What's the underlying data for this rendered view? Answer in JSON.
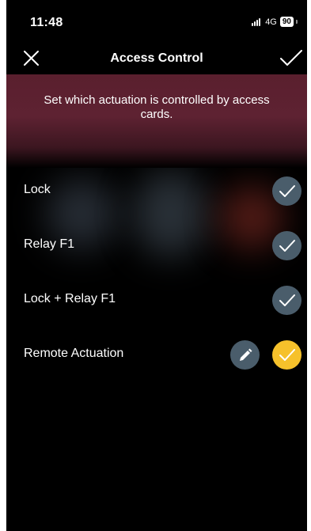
{
  "status_bar": {
    "time": "11:48",
    "network": "4G",
    "battery": "90"
  },
  "header": {
    "title": "Access Control",
    "close_icon": "close-icon",
    "confirm_icon": "checkmark-icon"
  },
  "banner": {
    "text": "Set which actuation is controlled by access cards."
  },
  "options": [
    {
      "label": "Lock",
      "state": "unselected"
    },
    {
      "label": "Relay F1",
      "state": "unselected"
    },
    {
      "label": "Lock + Relay F1",
      "state": "unselected"
    },
    {
      "label": "Remote Actuation",
      "state": "selected",
      "has_edit": true
    }
  ],
  "colors": {
    "background": "#000000",
    "banner": "#5e2232",
    "check_unselected": "#4a5d6b",
    "check_selected": "#f6c12b",
    "text": "#ffffff"
  }
}
